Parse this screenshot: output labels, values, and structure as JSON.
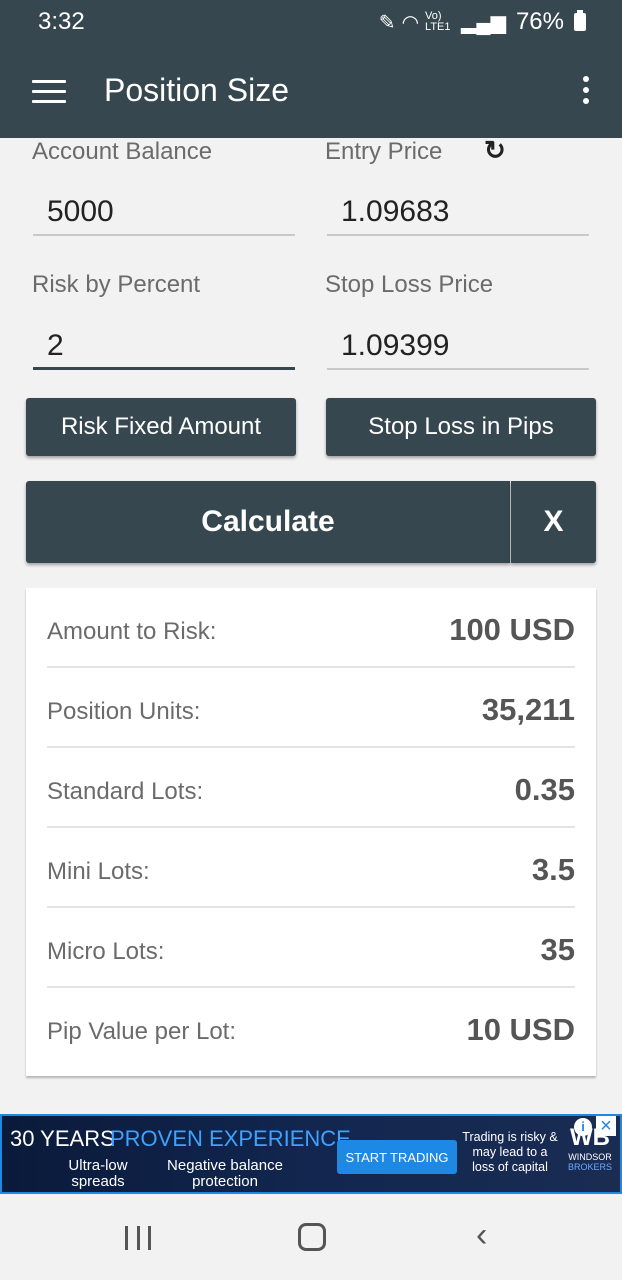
{
  "status": {
    "time": "3:32",
    "network": "Vo) LTE1",
    "battery": "76%"
  },
  "app_bar": {
    "title": "Position Size"
  },
  "form": {
    "account_balance": {
      "label": "Account Balance",
      "value": "5000"
    },
    "entry_price": {
      "label": "Entry Price",
      "value": "1.09683"
    },
    "risk_percent": {
      "label": "Risk by Percent",
      "value": "2"
    },
    "stop_loss_price": {
      "label": "Stop Loss Price",
      "value": "1.09399"
    }
  },
  "buttons": {
    "risk_fixed": "Risk Fixed Amount",
    "stop_loss_pips": "Stop Loss in Pips",
    "calculate": "Calculate",
    "clear": "X"
  },
  "results": [
    {
      "label": "Amount to Risk:",
      "value": "100 USD"
    },
    {
      "label": "Position Units:",
      "value": "35,211"
    },
    {
      "label": "Standard Lots:",
      "value": "0.35"
    },
    {
      "label": "Mini Lots:",
      "value": "3.5"
    },
    {
      "label": "Micro Lots:",
      "value": "35"
    },
    {
      "label": "Pip Value per Lot:",
      "value": "10 USD"
    }
  ],
  "ad": {
    "headline_1": "30 YEARS",
    "headline_2": "PROVEN EXPERIENCE",
    "sub_1": "Ultra-low spreads",
    "sub_2": "Negative balance protection",
    "cta": "START TRADING",
    "disclaimer": "Trading is risky & may lead to a loss of capital",
    "logo_mark": "WB",
    "logo_text_1": "WINDSOR",
    "logo_text_2": "BROKERS",
    "accent_color": "#1e88e5"
  },
  "colors": {
    "primary": "#37474f",
    "background": "#f2f2f2"
  }
}
